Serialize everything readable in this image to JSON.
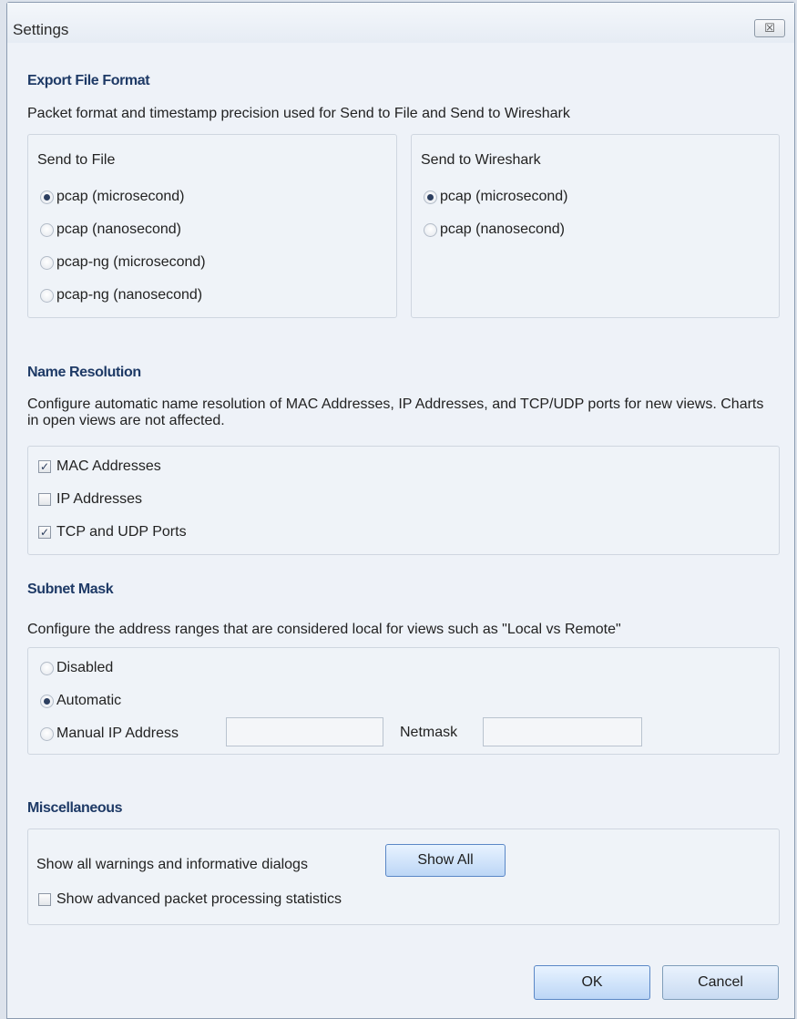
{
  "window": {
    "title": "Settings",
    "close_glyph": "☒"
  },
  "export": {
    "heading": "Export File Format",
    "description": "Packet format and timestamp precision used for Send to File and Send to Wireshark",
    "send_to_file": {
      "label": "Send to File",
      "options": [
        {
          "label": "pcap (microsecond)",
          "checked": true
        },
        {
          "label": "pcap (nanosecond)",
          "checked": false
        },
        {
          "label": "pcap-ng (microsecond)",
          "checked": false
        },
        {
          "label": "pcap-ng (nanosecond)",
          "checked": false
        }
      ]
    },
    "send_to_wireshark": {
      "label": "Send to Wireshark",
      "options": [
        {
          "label": "pcap (microsecond)",
          "checked": true
        },
        {
          "label": "pcap (nanosecond)",
          "checked": false
        }
      ]
    }
  },
  "name_resolution": {
    "heading": "Name Resolution",
    "description": "Configure automatic name resolution of MAC Addresses, IP Addresses, and TCP/UDP ports for new views. Charts in open views are not affected.",
    "options": [
      {
        "label": "MAC Addresses",
        "checked": true
      },
      {
        "label": "IP Addresses",
        "checked": false
      },
      {
        "label": "TCP and UDP Ports",
        "checked": true
      }
    ]
  },
  "subnet": {
    "heading": "Subnet Mask",
    "description": "Configure the address ranges that are considered local for views such as \"Local vs Remote\"",
    "options": [
      {
        "label": "Disabled",
        "checked": false
      },
      {
        "label": "Automatic",
        "checked": true
      },
      {
        "label": "Manual IP Address",
        "checked": false
      }
    ],
    "ip_value": "",
    "netmask_label": "Netmask",
    "netmask_value": ""
  },
  "misc": {
    "heading": "Miscellaneous",
    "warnings_label": "Show all warnings and informative dialogs",
    "show_all_label": "Show All",
    "advanced_stats_label": "Show advanced packet processing statistics",
    "advanced_stats_checked": false
  },
  "footer": {
    "ok_label": "OK",
    "cancel_label": "Cancel"
  },
  "colors": {
    "heading": "#1e3a66",
    "button_top": "#e8f3ff",
    "button_bottom": "#bcd6f6"
  }
}
